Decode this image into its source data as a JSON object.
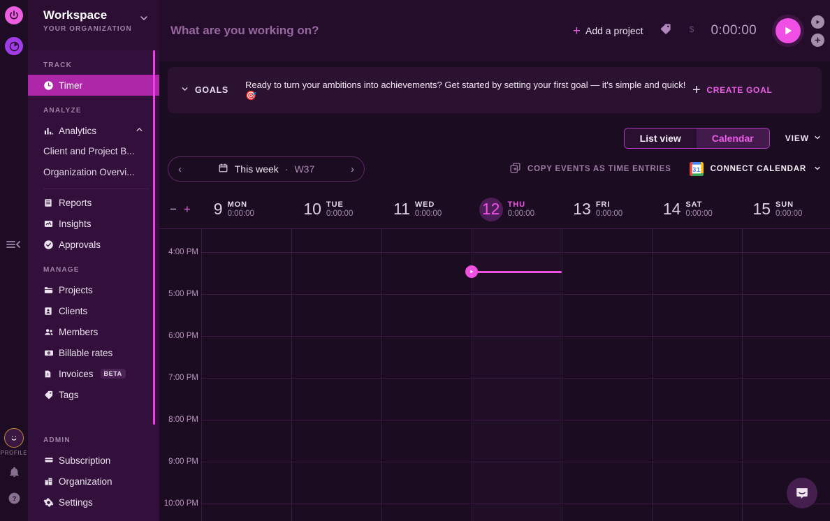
{
  "rail": {
    "logo_primary": "power-logo-icon",
    "logo_secondary": "clock-logo-icon",
    "collapse": "collapse-sidebar-icon",
    "profile_label": "PROFILE",
    "notifications": "bell-icon",
    "help": "help-icon"
  },
  "sidebar": {
    "workspace_title": "Workspace",
    "organization": "YOUR ORGANIZATION",
    "caret": "chevron-down-icon",
    "sections": [
      {
        "label": "TRACK",
        "items": [
          {
            "label": "Timer",
            "icon": "clock-icon",
            "active": true
          }
        ]
      },
      {
        "label": "ANALYZE",
        "items": [
          {
            "label": "Analytics",
            "icon": "bar-chart-icon",
            "expanded": true,
            "caret": "chevron-up-icon"
          },
          {
            "label": "Client and Project B...",
            "sub": true
          },
          {
            "label": "Organization Overvi...",
            "sub": true
          },
          {
            "label": "Reports",
            "icon": "report-icon",
            "after_divider": true
          },
          {
            "label": "Insights",
            "icon": "insights-icon"
          },
          {
            "label": "Approvals",
            "icon": "check-circle-icon"
          }
        ]
      },
      {
        "label": "MANAGE",
        "items": [
          {
            "label": "Projects",
            "icon": "folder-icon"
          },
          {
            "label": "Clients",
            "icon": "contact-card-icon"
          },
          {
            "label": "Members",
            "icon": "people-icon"
          },
          {
            "label": "Billable rates",
            "icon": "money-icon"
          },
          {
            "label": "Invoices",
            "icon": "invoice-icon",
            "badge": "BETA"
          },
          {
            "label": "Tags",
            "icon": "tag-icon"
          }
        ]
      },
      {
        "label": "ADMIN",
        "items": [
          {
            "label": "Subscription",
            "icon": "card-icon"
          },
          {
            "label": "Organization",
            "icon": "building-icon"
          },
          {
            "label": "Settings",
            "icon": "gear-icon"
          }
        ]
      }
    ]
  },
  "topbar": {
    "task_placeholder": "What are you working on?",
    "task_value": "",
    "add_project": "Add a project",
    "tag_icon": "tag-icon",
    "billable_icon": "dollar-icon",
    "timer": "0:00:00",
    "start_icon": "play-icon",
    "mini_play_icon": "play-small-icon",
    "mini_add_icon": "plus-small-icon"
  },
  "goals": {
    "toggle_label": "GOALS",
    "toggle_icon": "chevron-down-icon",
    "message": "Ready to turn your ambitions into achievements? Get started by setting your first goal — it's simple and quick! 🎯",
    "create_label": "CREATE GOAL",
    "create_icon": "plus-icon"
  },
  "viewrow": {
    "list_view": "List view",
    "calendar_view": "Calendar",
    "active_view": "Calendar",
    "view_menu": "VIEW",
    "view_menu_icon": "chevron-down-icon"
  },
  "daterow": {
    "prev_icon": "chevron-left-icon",
    "next_icon": "chevron-right-icon",
    "calendar_icon": "calendar-icon",
    "range_label": "This week",
    "separator": "·",
    "week_label": "W37",
    "copy_events": "COPY EVENTS AS TIME ENTRIES",
    "copy_icon": "copy-icon",
    "connect_calendar": "CONNECT CALENDAR",
    "gcal_icon": "google-calendar-icon",
    "gcal_day": "31",
    "connect_caret": "chevron-down-icon"
  },
  "calendar": {
    "zoom_out": "−",
    "zoom_in": "+",
    "days": [
      {
        "num": "9",
        "name": "MON",
        "total": "0:00:00",
        "today": false
      },
      {
        "num": "10",
        "name": "TUE",
        "total": "0:00:00",
        "today": false
      },
      {
        "num": "11",
        "name": "WED",
        "total": "0:00:00",
        "today": false
      },
      {
        "num": "12",
        "name": "THU",
        "total": "0:00:00",
        "today": true
      },
      {
        "num": "13",
        "name": "FRI",
        "total": "0:00:00",
        "today": false
      },
      {
        "num": "14",
        "name": "SAT",
        "total": "0:00:00",
        "today": false
      },
      {
        "num": "15",
        "name": "SUN",
        "total": "0:00:00",
        "today": false
      }
    ],
    "hours": [
      "4:00 PM",
      "5:00 PM",
      "6:00 PM",
      "7:00 PM",
      "8:00 PM",
      "9:00 PM",
      "10:00 PM"
    ],
    "now_indicator_icon": "play-small-icon"
  },
  "intercom": {
    "icon": "messenger-icon"
  },
  "colors": {
    "accent": "#ef4fe2",
    "sidebar_active": "#ad27a8",
    "sidebar_bg": "#330f3b",
    "panel_bg": "#1b0c21",
    "topbar_bg": "#230d2b",
    "grid_line": "#3a1a42"
  }
}
